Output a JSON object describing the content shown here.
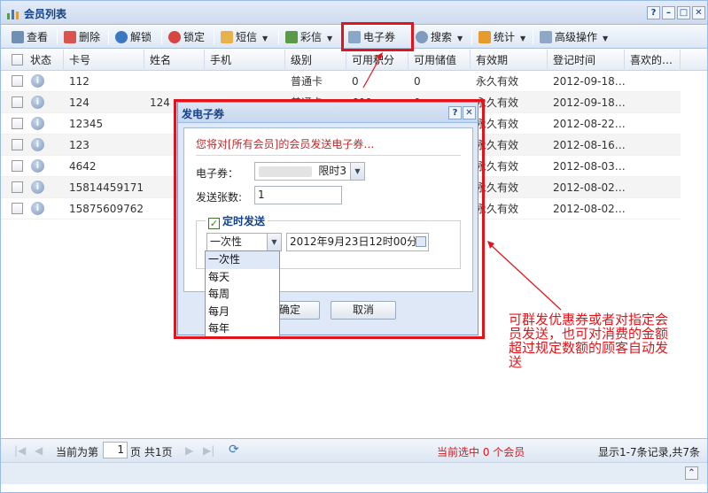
{
  "window": {
    "title": "会员列表",
    "controls": [
      "?",
      "–",
      "□",
      "✕"
    ]
  },
  "toolbar": {
    "items": [
      {
        "label": "查看",
        "icon": "view-icon",
        "color": "#6f8fb5"
      },
      {
        "label": "删除",
        "icon": "delete-icon",
        "color": "#d9534f"
      },
      {
        "label": "解锁",
        "icon": "unlock-icon",
        "color": "#3a78c2"
      },
      {
        "label": "锁定",
        "icon": "lock-icon",
        "color": "#d64541"
      },
      {
        "label": "短信",
        "icon": "sms-icon",
        "color": "#e8b14a"
      },
      {
        "label": "彩信",
        "icon": "mms-icon",
        "color": "#5a9a45"
      },
      {
        "label": "电子券",
        "icon": "ecoupon-icon",
        "color": "#8aa6c8"
      },
      {
        "label": "搜索",
        "icon": "search-icon",
        "color": "#7f9bbf"
      },
      {
        "label": "统计",
        "icon": "stats-icon",
        "color": "#e79a2e"
      },
      {
        "label": "高级操作",
        "icon": "advanced-icon",
        "color": "#8fa7c6"
      }
    ]
  },
  "grid": {
    "columns": [
      "状态",
      "卡号",
      "姓名",
      "手机",
      "级别",
      "可用积分",
      "可用储值",
      "有效期",
      "登记时间",
      "喜欢的…"
    ],
    "rows": [
      {
        "card": "112",
        "name": "",
        "mobile": "",
        "level": "普通卡",
        "points": "0",
        "balance": "0",
        "validity": "永久有效",
        "date": "2012-09-18…"
      },
      {
        "card": "124",
        "name": "124",
        "mobile": "",
        "level": "普通卡",
        "points": "600",
        "balance": "0",
        "validity": "永久有效",
        "date": "2012-09-18…"
      },
      {
        "card": "12345",
        "name": "",
        "mobile": "",
        "level": "",
        "points": "",
        "balance": "",
        "validity": "永久有效",
        "date": "2012-08-22…"
      },
      {
        "card": "123",
        "name": "",
        "mobile": "",
        "level": "",
        "points": "",
        "balance": "",
        "validity": "永久有效",
        "date": "2012-08-16…"
      },
      {
        "card": "4642",
        "name": "",
        "mobile": "",
        "level": "",
        "points": "",
        "balance": "",
        "validity": "永久有效",
        "date": "2012-08-03…"
      },
      {
        "card": "15814459171",
        "name": "",
        "mobile": "",
        "level": "",
        "points": "",
        "balance": "",
        "validity": "永久有效",
        "date": "2012-08-02…"
      },
      {
        "card": "15875609762",
        "name": "",
        "mobile": "",
        "level": "",
        "points": "",
        "balance": "",
        "validity": "永久有效",
        "date": "2012-08-02…"
      }
    ]
  },
  "pager": {
    "prefix": "当前为第",
    "page": "1",
    "suffix": "页 共1页",
    "selected": "当前选中 0 个会员",
    "summary": "显示1-7条记录,共7条"
  },
  "dialog": {
    "title": "发电子券",
    "controls": [
      "?",
      "✕"
    ],
    "notice": "您将对[所有会员]的会员发送电子券…",
    "coupon_label": "电子券：",
    "coupon_value": "限时3",
    "count_label": "发送张数:",
    "count_value": "1",
    "schedule_label": "定时发送",
    "frequency_value": "一次性",
    "datetime_value": "2012年9月23日12时00分",
    "ok_label": "确定",
    "cancel_label": "取消",
    "frequency_options": [
      "一次性",
      "每天",
      "每周",
      "每月",
      "每年"
    ]
  },
  "annotation": {
    "text": "可群发优惠券或者对指定会员发送，也可对消费的金额超过规定数额的顾客自动发送",
    "color": "#e0141a"
  }
}
